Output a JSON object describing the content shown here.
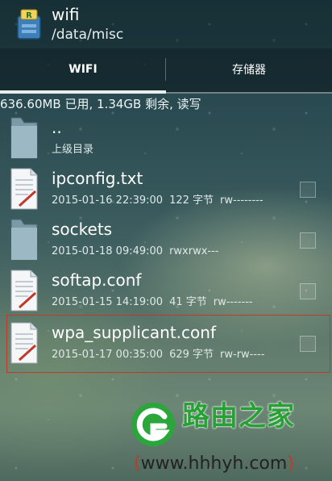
{
  "header": {
    "folder_name": "wifi",
    "folder_path": "/data/misc"
  },
  "tabs": [
    {
      "label": "WIFI",
      "active": true
    },
    {
      "label": "存储器",
      "active": false
    }
  ],
  "storage_info": "636.60MB 已用, 1.34GB 剩余, 读写",
  "files": [
    {
      "name": "..",
      "type": "folder",
      "date": "",
      "size": "",
      "perms": "",
      "subtitle": "上级目录",
      "has_checkbox": false
    },
    {
      "name": "ipconfig.txt",
      "type": "file",
      "date": "2015-01-16 22:39:00",
      "size": "122 字节",
      "perms": "rw--------",
      "subtitle": "",
      "has_checkbox": true
    },
    {
      "name": "sockets",
      "type": "folder",
      "date": "2015-01-18 09:49:00",
      "size": "",
      "perms": "rwxrwx---",
      "subtitle": "",
      "has_checkbox": true
    },
    {
      "name": "softap.conf",
      "type": "file",
      "date": "2015-01-15 14:19:00",
      "size": "41 字节",
      "perms": "rw-------",
      "subtitle": "",
      "has_checkbox": true
    },
    {
      "name": "wpa_supplicant.conf",
      "type": "file",
      "date": "2015-01-17 00:35:00",
      "size": "629 字节",
      "perms": "rw-rw----",
      "subtitle": "",
      "has_checkbox": true
    }
  ],
  "watermark": {
    "title": "路由之家",
    "url_open": "(",
    "url_text": "www.hhhyh.com",
    "url_close": ")"
  },
  "colors": {
    "accent_green": "#27a035",
    "watermark_red": "#c0392b",
    "highlight_border": "#c0392b"
  }
}
